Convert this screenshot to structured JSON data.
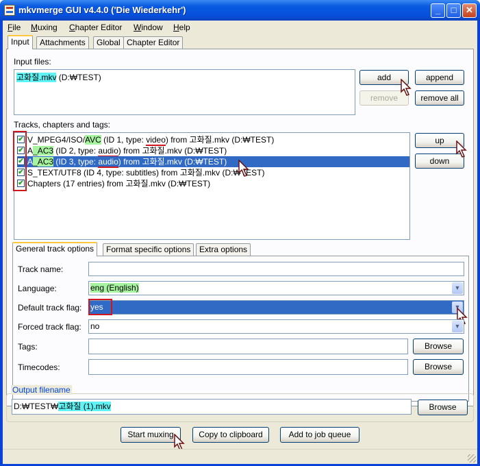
{
  "window": {
    "title": "mkvmerge GUI v4.4.0 ('Die Wiederkehr')"
  },
  "titlebar_buttons": {
    "minimize": "_",
    "maximize": "□",
    "close": "✕"
  },
  "menu": [
    {
      "label": "File",
      "u": "F",
      "rest": "ile"
    },
    {
      "label": "Muxing",
      "u": "M",
      "rest": "uxing"
    },
    {
      "label": "Chapter Editor",
      "u": "C",
      "rest": "hapter Editor"
    },
    {
      "label": "Window",
      "u": "W",
      "rest": "indow"
    },
    {
      "label": "Help",
      "u": "H",
      "rest": "elp"
    }
  ],
  "tabs": [
    "Input",
    "Attachments",
    "Global",
    "Chapter Editor"
  ],
  "input_files": {
    "label": "Input files:",
    "file_name": "고화질.mkv",
    "file_path": "(D:₩TEST)"
  },
  "buttons": {
    "add": "add",
    "append": "append",
    "remove": "remove",
    "remove_all": "remove all",
    "up": "up",
    "down": "down",
    "browse": "Browse",
    "start_muxing": "Start muxing",
    "copy_clipboard": "Copy to clipboard",
    "add_job_queue": "Add to job queue"
  },
  "tracks": {
    "label": "Tracks, chapters and tags:",
    "checkmark": "✔",
    "rows": [
      {
        "pre": "V_MPEG4/ISO/",
        "hl": "AVC",
        "mid": " (ID 1, type: ",
        "type": "video",
        "post": ") from 고화질.mkv (D:₩TEST)"
      },
      {
        "pre": "A",
        "hl": "_AC3",
        "mid": " (ID 2, type: ",
        "type": "audio",
        "post": ") from 고화질.mkv (D:₩TEST)"
      },
      {
        "pre": "A",
        "hl": "_AC3",
        "mid": " (ID 3, type: ",
        "type": "audio",
        "post": ") from 고화질.mkv (D:₩TEST)"
      },
      {
        "text": "S_TEXT/UTF8 (ID 4, type: subtitles) from 고화질.mkv (D:₩TEST)"
      },
      {
        "text": "Chapters (17 entries) from 고화질.mkv (D:₩TEST)"
      }
    ]
  },
  "subtabs": [
    "General track options",
    "Format specific options",
    "Extra options"
  ],
  "fields": {
    "track_name": {
      "label": "Track name:",
      "value": ""
    },
    "language": {
      "label": "Language:",
      "value": "eng (English)"
    },
    "default_flag": {
      "label": "Default track flag:",
      "value": "yes"
    },
    "forced_flag": {
      "label": "Forced track flag:",
      "value": "no"
    },
    "tags": {
      "label": "Tags:",
      "value": ""
    },
    "timecodes": {
      "label": "Timecodes:",
      "value": ""
    }
  },
  "output": {
    "group_title": "Output filename",
    "prefix": "D:₩TEST₩",
    "file": "고화질 (1).mkv"
  },
  "colors": {
    "accent_highlight": "#5ff3f6",
    "language_highlight": "#a7f3a0",
    "annotation_red": "#d0161a",
    "selection": "#316ac5"
  }
}
